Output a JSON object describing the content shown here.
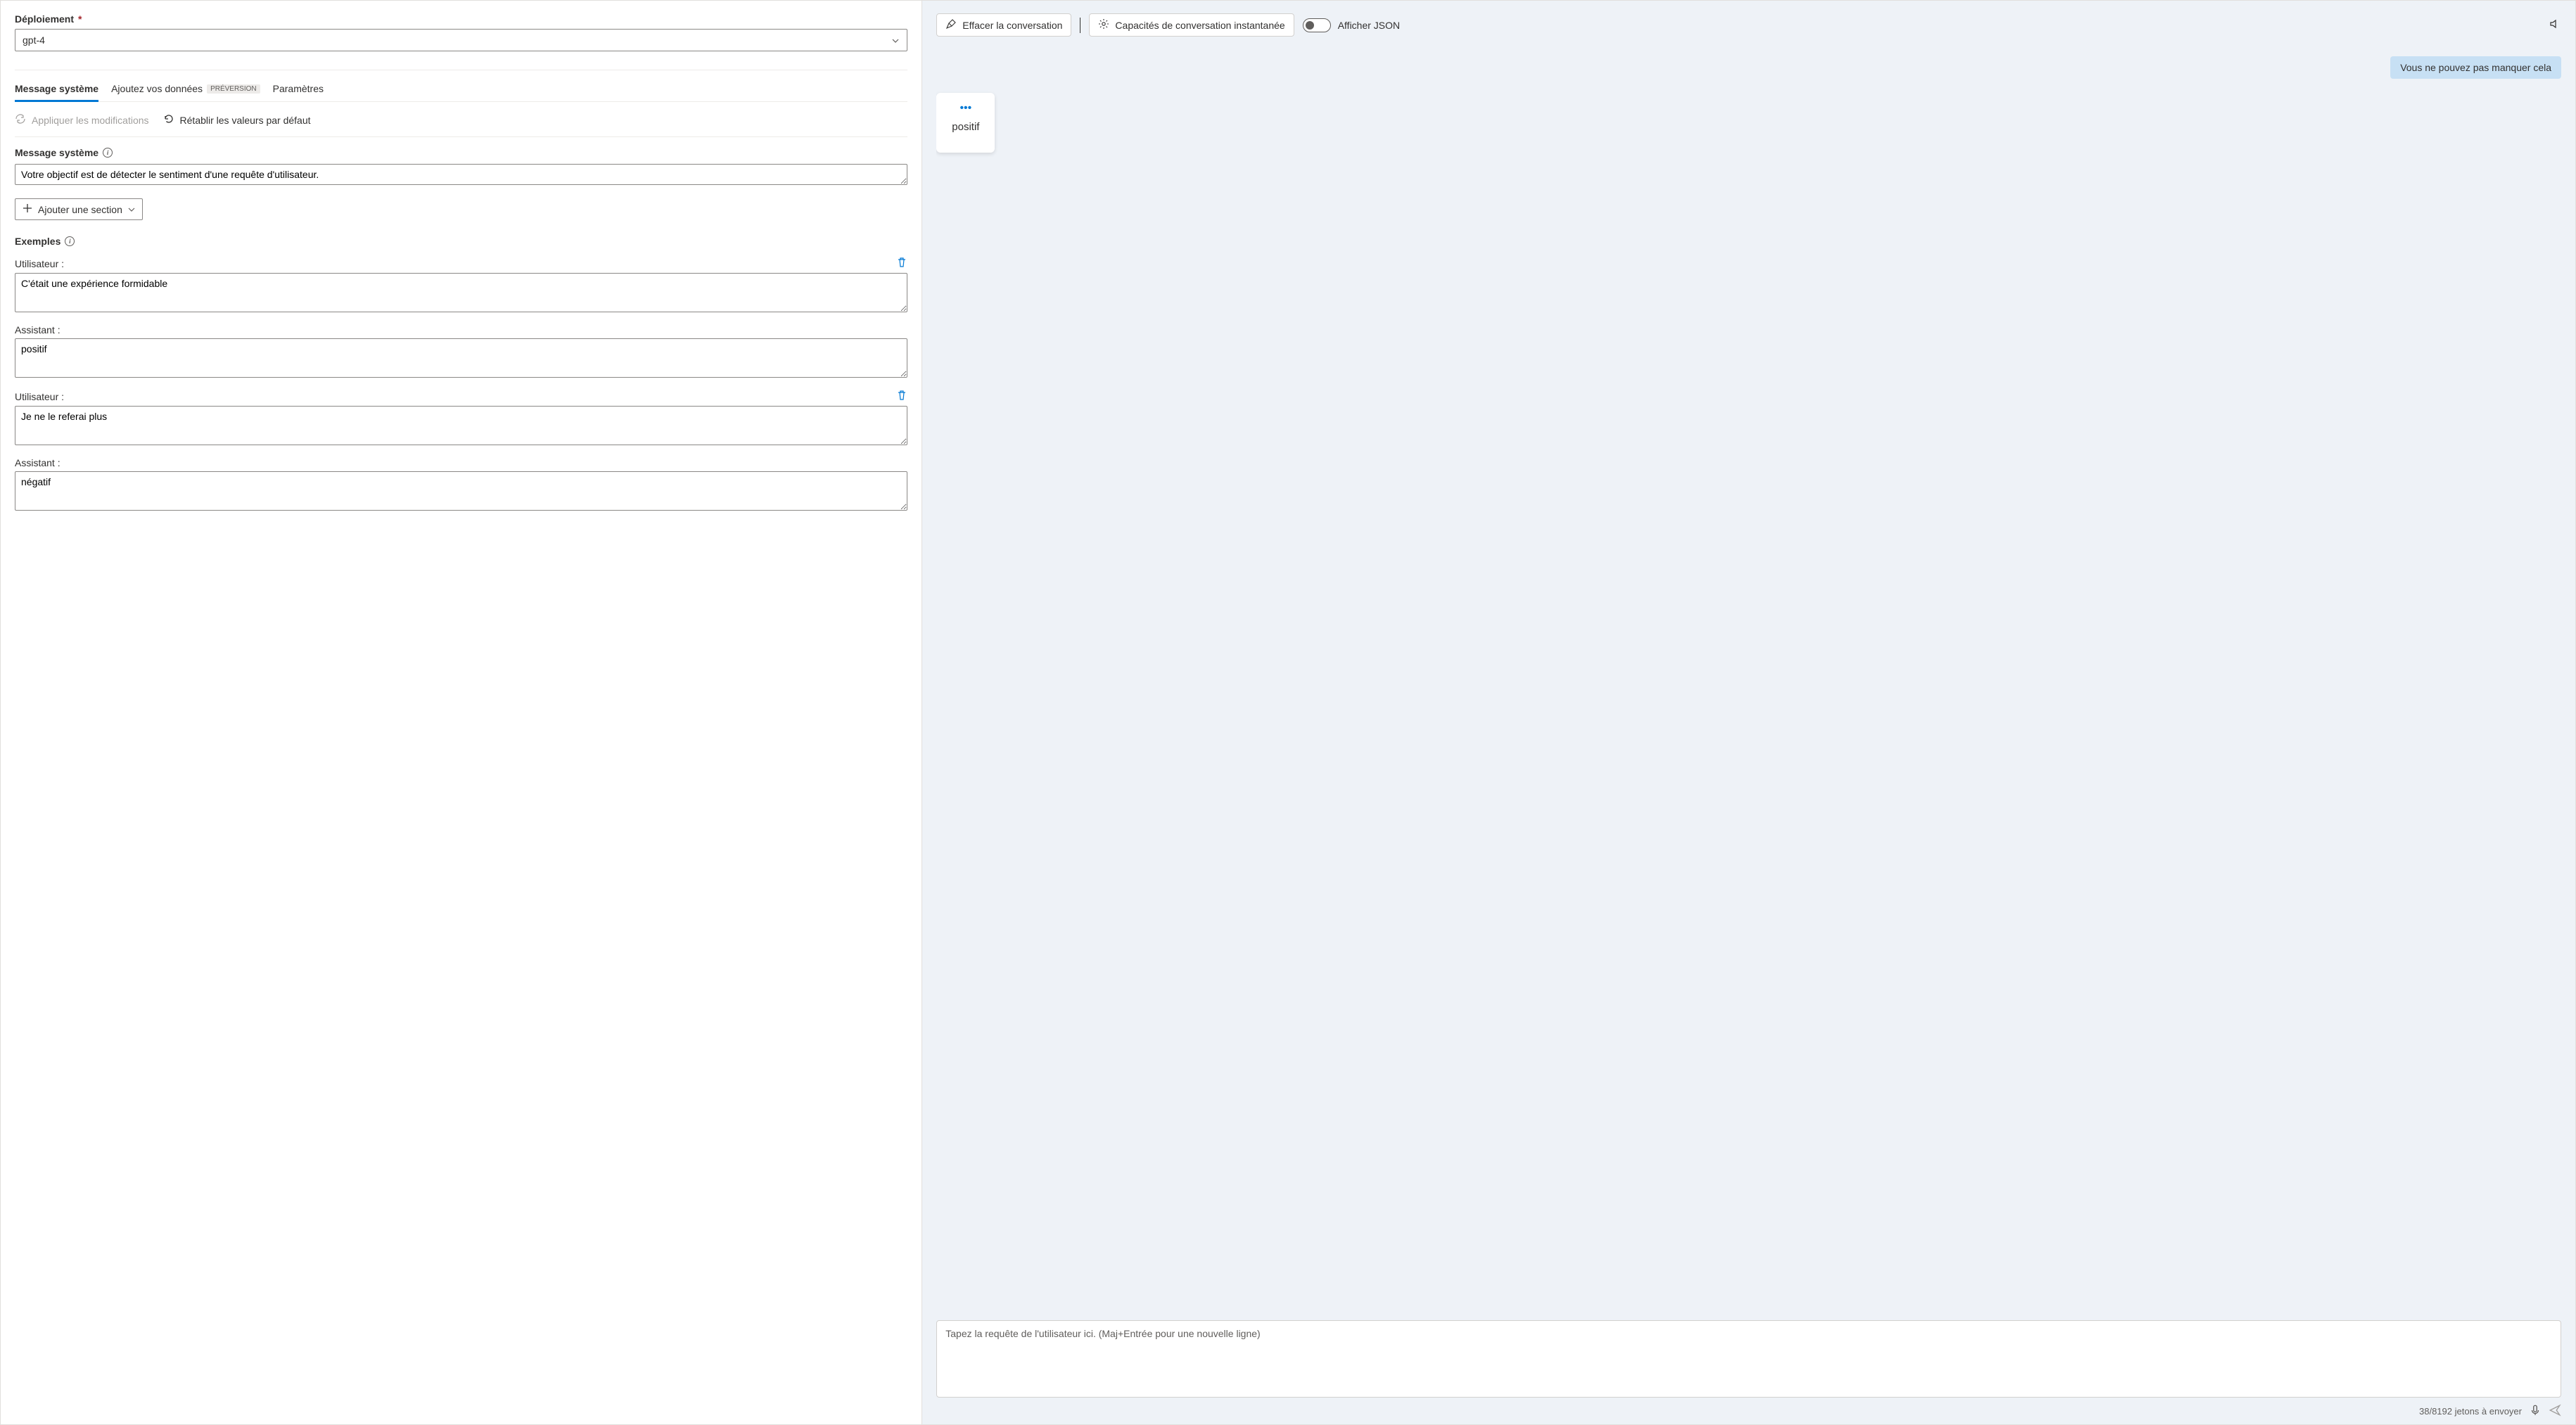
{
  "left": {
    "deployment_label": "Déploiement",
    "deployment_value": "gpt-4",
    "tabs": {
      "system": "Message système",
      "add_data": "Ajoutez vos données",
      "add_data_badge": "PRÉVERSION",
      "params": "Paramètres"
    },
    "actions": {
      "apply": "Appliquer les modifications",
      "reset": "Rétablir les valeurs par défaut"
    },
    "system_msg_label": "Message système",
    "system_msg_value": "Votre objectif est de détecter le sentiment d'une requête d'utilisateur.",
    "add_section": "Ajouter une section",
    "examples_label": "Exemples",
    "user_label": "Utilisateur :",
    "assistant_label": "Assistant :",
    "examples": [
      {
        "user": "C'était une expérience formidable",
        "assistant": "positif"
      },
      {
        "user": "Je ne le referai plus",
        "assistant": "négatif"
      }
    ]
  },
  "right": {
    "clear": "Effacer la conversation",
    "capabilities": "Capacités de conversation instantanée",
    "show_json": "Afficher JSON",
    "user_message": "Vous ne pouvez pas manquer cela",
    "assistant_message": "positif",
    "input_placeholder": "Tapez la requête de l'utilisateur ici. (Maj+Entrée pour une nouvelle ligne)",
    "token_status": "38/8192 jetons à envoyer"
  }
}
